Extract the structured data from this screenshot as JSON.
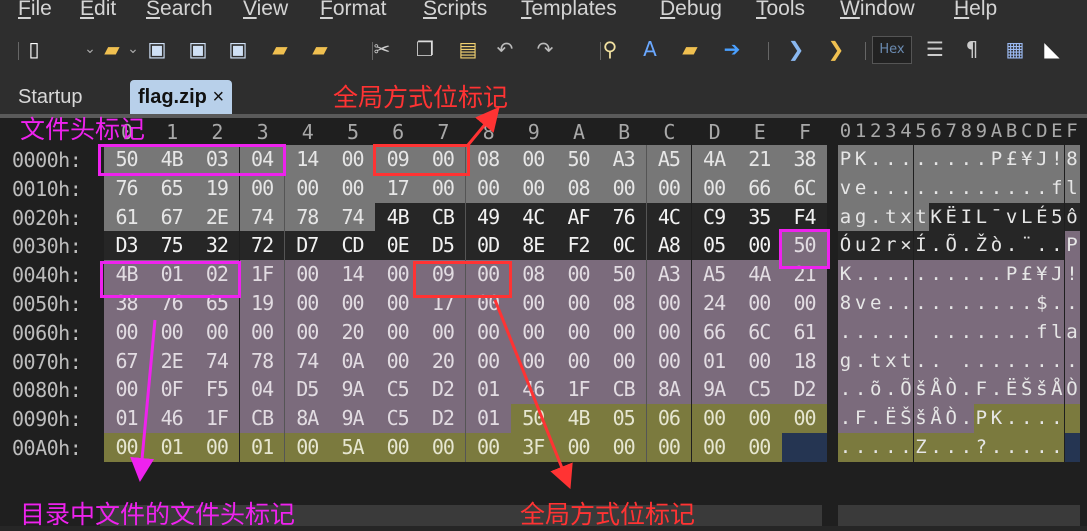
{
  "menu": [
    "File",
    "Edit",
    "Search",
    "View",
    "Format",
    "Scripts",
    "Templates",
    "Debug",
    "Tools",
    "Window",
    "Help"
  ],
  "toolbar": {
    "icons": [
      "new-file-icon",
      "chevron-down-icon",
      "open-folder-icon",
      "chevron-down-icon",
      "save-icon",
      "save-as-icon",
      "save-all-icon",
      "folder-icon",
      "open-multiple-icon",
      "cut-icon",
      "copy-icon",
      "paste-icon",
      "undo-icon",
      "redo-icon",
      "find-icon",
      "replace-icon",
      "find-in-files-icon",
      "goto-icon",
      "run-script-icon",
      "run-template-icon",
      "hex-mode-icon",
      "text-compare-icon",
      "pilcrow-icon",
      "columns-icon",
      "highlight-icon"
    ],
    "hex_label": "Hex"
  },
  "tabs": [
    {
      "label": "Startup",
      "active": false
    },
    {
      "label": "flag.zip",
      "active": true,
      "close": "×"
    }
  ],
  "hex_view": {
    "column_headers": [
      "0",
      "1",
      "2",
      "3",
      "4",
      "5",
      "6",
      "7",
      "8",
      "9",
      "A",
      "B",
      "C",
      "D",
      "E",
      "F"
    ],
    "ascii_header": "0123456789ABCDEF",
    "rows": [
      {
        "addr": "0000h:",
        "bytes": [
          "50",
          "4B",
          "03",
          "04",
          "14",
          "00",
          "09",
          "00",
          "08",
          "00",
          "50",
          "A3",
          "A5",
          "4A",
          "21",
          "38"
        ],
        "ascii": "PK........P£¥J!8"
      },
      {
        "addr": "0010h:",
        "bytes": [
          "76",
          "65",
          "19",
          "00",
          "00",
          "00",
          "17",
          "00",
          "00",
          "00",
          "08",
          "00",
          "00",
          "00",
          "66",
          "6C"
        ],
        "ascii": "ve............fl"
      },
      {
        "addr": "0020h:",
        "bytes": [
          "61",
          "67",
          "2E",
          "74",
          "78",
          "74",
          "4B",
          "CB",
          "49",
          "4C",
          "AF",
          "76",
          "4C",
          "C9",
          "35",
          "F4"
        ],
        "ascii": "ag.txtKËIL¯vLÉ5ô"
      },
      {
        "addr": "0030h:",
        "bytes": [
          "D3",
          "75",
          "32",
          "72",
          "D7",
          "CD",
          "0E",
          "D5",
          "0D",
          "8E",
          "F2",
          "0C",
          "A8",
          "05",
          "00",
          "50"
        ],
        "ascii": "Óu2r×Í.Õ.Žò.¨..P"
      },
      {
        "addr": "0040h:",
        "bytes": [
          "4B",
          "01",
          "02",
          "1F",
          "00",
          "14",
          "00",
          "09",
          "00",
          "08",
          "00",
          "50",
          "A3",
          "A5",
          "4A",
          "21"
        ],
        "ascii": "K..........P£¥J!"
      },
      {
        "addr": "0050h:",
        "bytes": [
          "38",
          "76",
          "65",
          "19",
          "00",
          "00",
          "00",
          "17",
          "00",
          "00",
          "00",
          "08",
          "00",
          "24",
          "00",
          "00"
        ],
        "ascii": "8ve..........$.."
      },
      {
        "addr": "0060h:",
        "bytes": [
          "00",
          "00",
          "00",
          "00",
          "00",
          "20",
          "00",
          "00",
          "00",
          "00",
          "00",
          "00",
          "00",
          "66",
          "6C",
          "61"
        ],
        "ascii": "..... .......fla"
      },
      {
        "addr": "0070h:",
        "bytes": [
          "67",
          "2E",
          "74",
          "78",
          "74",
          "0A",
          "00",
          "20",
          "00",
          "00",
          "00",
          "00",
          "00",
          "01",
          "00",
          "18"
        ],
        "ascii": "g.txt.. ........"
      },
      {
        "addr": "0080h:",
        "bytes": [
          "00",
          "0F",
          "F5",
          "04",
          "D5",
          "9A",
          "C5",
          "D2",
          "01",
          "46",
          "1F",
          "CB",
          "8A",
          "9A",
          "C5",
          "D2"
        ],
        "ascii": "..õ.ÕšÅÒ.F.ËŠšÅÒ"
      },
      {
        "addr": "0090h:",
        "bytes": [
          "01",
          "46",
          "1F",
          "CB",
          "8A",
          "9A",
          "C5",
          "D2",
          "01",
          "50",
          "4B",
          "05",
          "06",
          "00",
          "00",
          "00"
        ],
        "ascii": ".F.ËŠšÅÒ.PK...."
      },
      {
        "addr": "00A0h:",
        "bytes": [
          "00",
          "01",
          "00",
          "01",
          "00",
          "5A",
          "00",
          "00",
          "00",
          "3F",
          "00",
          "00",
          "00",
          "00",
          "00"
        ],
        "ascii": ".....Z...?....."
      }
    ],
    "regions": [
      {
        "name": "local-file-header",
        "start": 0,
        "end": 37,
        "bg": "#777777",
        "fg": "#e6e6e6"
      },
      {
        "name": "file-data",
        "start": 38,
        "end": 62,
        "bg": "#262626",
        "fg": "#f2f2f2"
      },
      {
        "name": "central-directory",
        "start": 63,
        "end": 152,
        "bg": "#7b6b7c",
        "fg": "#e2dce2"
      },
      {
        "name": "end-of-central-directory",
        "start": 153,
        "end": 174,
        "bg": "#7b7a3e",
        "fg": "#e6e6d0"
      }
    ],
    "cursor_color": "#253552"
  },
  "annotations": {
    "file_header_mark": "文件头标记",
    "global_flag_mark_top": "全局方式位标记",
    "dir_file_header_mark": "目录中文件的文件头标记",
    "global_flag_mark_bottom": "全局方式位标记",
    "magenta": "#ee22ee",
    "red": "#ff3333"
  }
}
